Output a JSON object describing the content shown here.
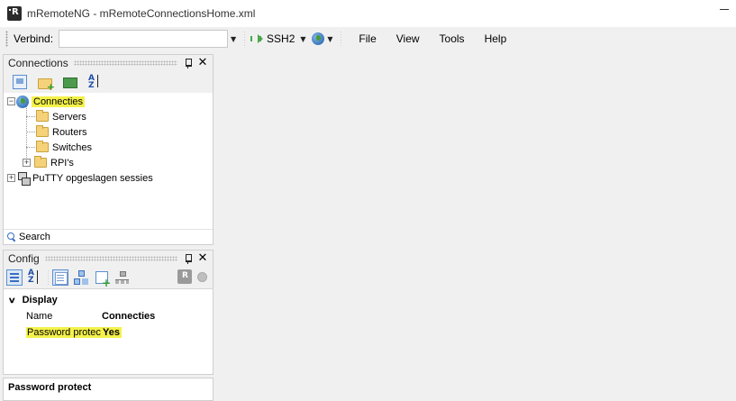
{
  "window": {
    "title": "mRemoteNG - mRemoteConnectionsHome.xml"
  },
  "toolbar": {
    "connect_label": "Verbind:",
    "connect_value": "",
    "protocol_label": "SSH2",
    "menu": [
      "File",
      "View",
      "Tools",
      "Help"
    ]
  },
  "connections_panel": {
    "title": "Connections",
    "tree": {
      "root_label": "Connecties",
      "children": [
        "Servers",
        "Routers",
        "Switches",
        "RPI's"
      ],
      "putty_label": "PuTTY opgeslagen sessies"
    },
    "search_label": "Search"
  },
  "config_panel": {
    "title": "Config",
    "category": "Display",
    "properties": [
      {
        "name": "Name",
        "value": "Connecties"
      },
      {
        "name": "Password protect",
        "value": "Yes"
      }
    ],
    "description_title": "Password protect"
  },
  "colors": {
    "highlight": "#f4f14a",
    "chrome": "#f0f0f0",
    "panel_bg": "#ffffff"
  }
}
